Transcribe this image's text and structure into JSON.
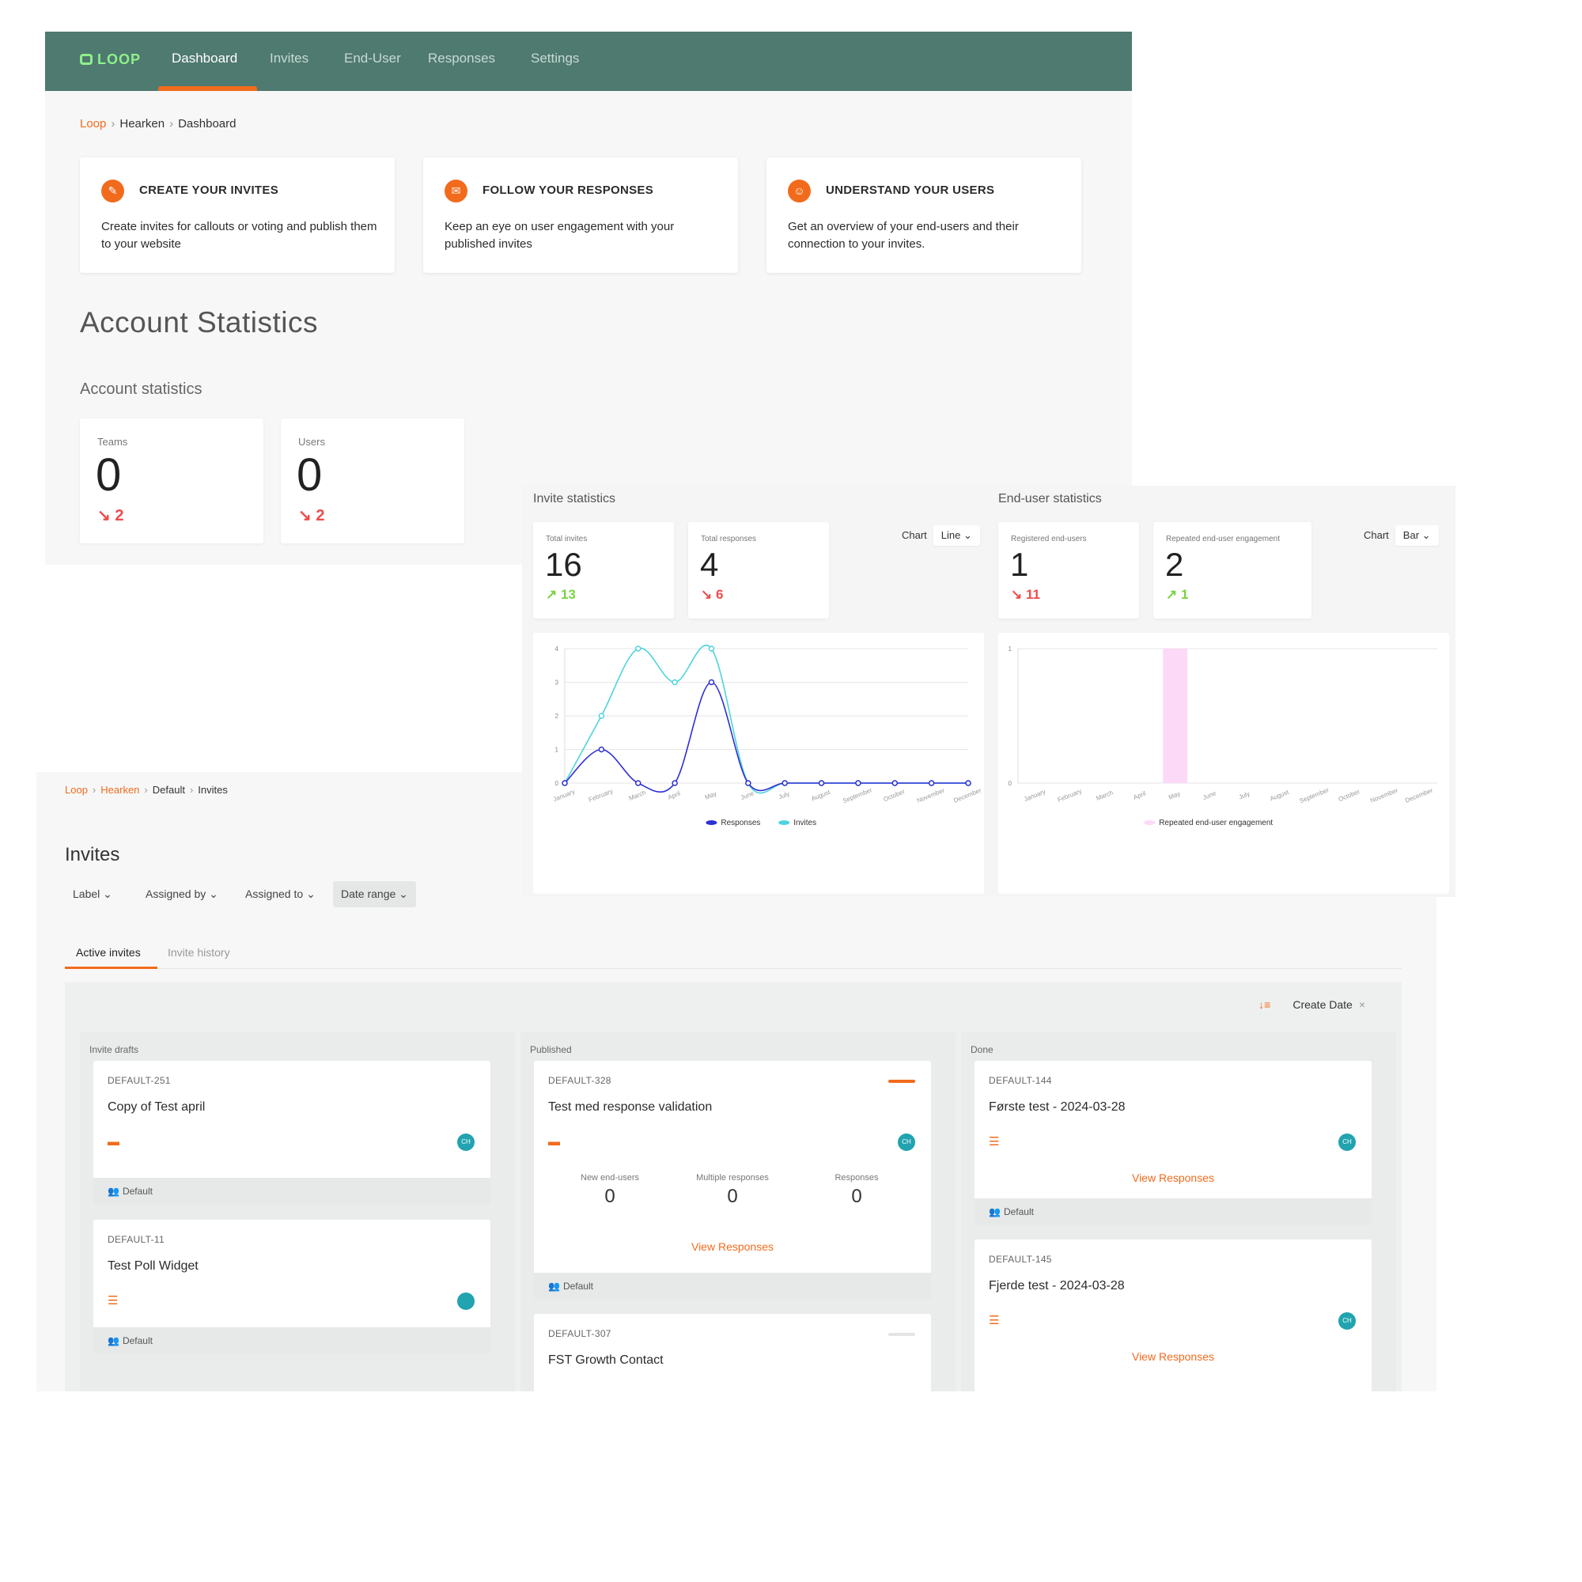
{
  "dashboard": {
    "logo": "LOOP",
    "nav": [
      "Dashboard",
      "Invites",
      "End-User",
      "Responses",
      "Settings"
    ],
    "breadcrumb": [
      "Loop",
      "Hearken",
      "Dashboard"
    ],
    "features": [
      {
        "title": "CREATE YOUR INVITES",
        "desc": "Create invites for callouts or voting and publish them to your website",
        "icon": "invite-icon"
      },
      {
        "title": "FOLLOW YOUR RESPONSES",
        "desc": "Keep an eye on user engagement with your published invites",
        "icon": "mail-icon"
      },
      {
        "title": "UNDERSTAND YOUR USERS",
        "desc": "Get an overview of your end-users and their connection to your invites.",
        "icon": "users-icon"
      }
    ],
    "heading": "Account Statistics",
    "subheading": "Account statistics",
    "account_stats": [
      {
        "label": "Teams",
        "value": "0",
        "trend": "2",
        "direction": "down"
      },
      {
        "label": "Users",
        "value": "0",
        "trend": "2",
        "direction": "down"
      }
    ]
  },
  "stats": {
    "invite_title": "Invite statistics",
    "enduser_title": "End-user statistics",
    "chart_label": "Chart",
    "invite_chart_type": "Line",
    "enduser_chart_type": "Bar",
    "invite_cards": [
      {
        "label": "Total invites",
        "value": "16",
        "trend": "13",
        "direction": "up"
      },
      {
        "label": "Total responses",
        "value": "4",
        "trend": "6",
        "direction": "down"
      }
    ],
    "enduser_cards": [
      {
        "label": "Registered end-users",
        "value": "1",
        "trend": "11",
        "direction": "down"
      },
      {
        "label": "Repeated end-user engagement",
        "value": "2",
        "trend": "1",
        "direction": "up"
      }
    ]
  },
  "chart_data": [
    {
      "type": "line",
      "x": [
        "January",
        "February",
        "March",
        "April",
        "May",
        "June",
        "July",
        "August",
        "September",
        "October",
        "November",
        "December"
      ],
      "ylim": [
        0,
        4
      ],
      "yticks": [
        "0",
        "1",
        "2",
        "3",
        "4"
      ],
      "series": [
        {
          "name": "Responses",
          "color": "#2d2fd3",
          "values": [
            0,
            1,
            0,
            0,
            3,
            0,
            0,
            0,
            0,
            0,
            0,
            0
          ]
        },
        {
          "name": "Invites",
          "color": "#4fd3dd",
          "values": [
            0,
            2,
            4,
            3,
            4,
            0,
            0,
            0,
            0,
            0,
            0,
            0
          ]
        }
      ],
      "grid": true,
      "legend": "bottom"
    },
    {
      "type": "bar",
      "categories": [
        "January",
        "February",
        "March",
        "April",
        "May",
        "June",
        "July",
        "August",
        "September",
        "October",
        "November",
        "December"
      ],
      "ylim": [
        0,
        1
      ],
      "yticks": [
        "0",
        "1"
      ],
      "series": [
        {
          "name": "Repeated end-user engagement",
          "color": "#fbd9f7",
          "values": [
            0,
            0,
            0,
            0,
            1,
            0,
            0,
            0,
            0,
            0,
            0,
            0
          ]
        }
      ],
      "grid": true,
      "legend": "bottom"
    }
  ],
  "invites": {
    "breadcrumb": [
      "Loop",
      "Hearken",
      "Default",
      "Invites"
    ],
    "title": "Invites",
    "filters": [
      "Label",
      "Assigned by",
      "Assigned to",
      "Date range"
    ],
    "tabs": [
      "Active invites",
      "Invite history"
    ],
    "sort_label": "Create Date",
    "columns": {
      "drafts": {
        "title": "Invite drafts",
        "cards": [
          {
            "key": "DEFAULT-251",
            "name": "Copy of Test april",
            "avatar": "CH",
            "team": "Default"
          },
          {
            "key": "DEFAULT-11",
            "name": "Test Poll Widget",
            "avatar": "",
            "team": "Default"
          }
        ]
      },
      "published": {
        "title": "Published",
        "cards": [
          {
            "key": "DEFAULT-328",
            "name": "Test med response validation",
            "avatar": "CH",
            "team": "Default",
            "status_color": "#f26b1d",
            "stats": [
              {
                "label": "New end-users",
                "value": "0"
              },
              {
                "label": "Multiple responses",
                "value": "0"
              },
              {
                "label": "Responses",
                "value": "0"
              }
            ],
            "link": "View Responses"
          },
          {
            "key": "DEFAULT-307",
            "name": "FST Growth Contact",
            "status_color": "#e5e5e5"
          }
        ]
      },
      "done": {
        "title": "Done",
        "cards": [
          {
            "key": "DEFAULT-144",
            "name": "Første test - 2024-03-28",
            "avatar": "CH",
            "team": "Default",
            "link": "View Responses"
          },
          {
            "key": "DEFAULT-145",
            "name": "Fjerde test - 2024-03-28",
            "avatar": "CH",
            "link": "View Responses"
          }
        ]
      }
    }
  },
  "colors": {
    "nav_bg": "#4f7a70",
    "accent": "#f26b1d",
    "logo": "#8ef08a",
    "trend_up": "#7ad342",
    "trend_down": "#ef4b4b",
    "avatar": "#21a3b0"
  }
}
